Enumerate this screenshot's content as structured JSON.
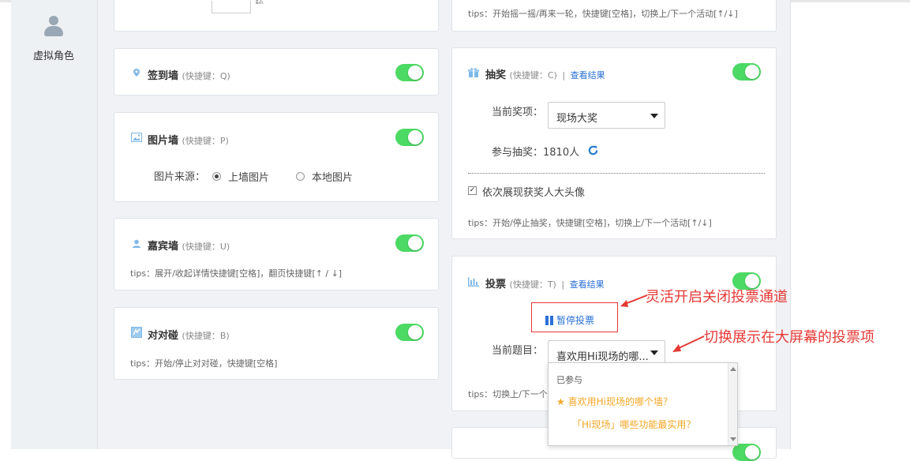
{
  "sidebar": {
    "label": "虚拟角色"
  },
  "top_left_card": {
    "unit": "秒"
  },
  "top_right_card": {
    "tips": "tips：开始摇一摇/再来一轮，快捷键[空格]，切换上/下一个活动[↑/↓]"
  },
  "sign_wall": {
    "title": "签到墙",
    "shortcut": "(快捷键：Q)"
  },
  "photo_wall": {
    "title": "图片墙",
    "shortcut": "(快捷键：P)",
    "source_label": "图片来源：",
    "options": [
      "上墙图片",
      "本地图片"
    ]
  },
  "guest_wall": {
    "title": "嘉宾墙",
    "shortcut": "(快捷键：U)",
    "tips": "tips：展开/收起详情快捷键[空格]，翻页快捷键[↑ / ↓]"
  },
  "pair_game": {
    "title": "对对碰",
    "shortcut": "(快捷键：B)",
    "tips": "tips：开始/停止对对碰，快捷键[空格]"
  },
  "lottery": {
    "title": "抽奖",
    "shortcut": "(快捷键：C)",
    "separator": "|",
    "link": "查看结果",
    "prize_label": "当前奖项：",
    "prize_value": "现场大奖",
    "participants": "参与抽奖：1810人",
    "checkbox_label": "依次展现获奖人大头像",
    "tips": "tips：开始/停止抽奖，快捷键[空格]，切换上/下一个活动[↑/↓]"
  },
  "vote": {
    "title": "投票",
    "shortcut": "(快捷键：T)",
    "separator": "|",
    "link": "查看结果",
    "pause_button": "暂停投票",
    "question_label": "当前题目：",
    "question_value": "喜欢用Hi现场的哪...",
    "tips": "tips：切换上/下一个",
    "dropdown": {
      "group_label": "已参与",
      "items": [
        "喜欢用Hi现场的哪个墙？",
        "「Hi现场」哪些功能最实用？"
      ]
    }
  },
  "annotations": {
    "toggle_note": "灵活开启关闭投票通道",
    "switch_note": "切换展示在大屏幕的投票项"
  },
  "colors": {
    "toggle_on": "#4cd964",
    "link": "#2a6fd6",
    "annotation": "#e53935",
    "highlight": "#f5a623"
  }
}
